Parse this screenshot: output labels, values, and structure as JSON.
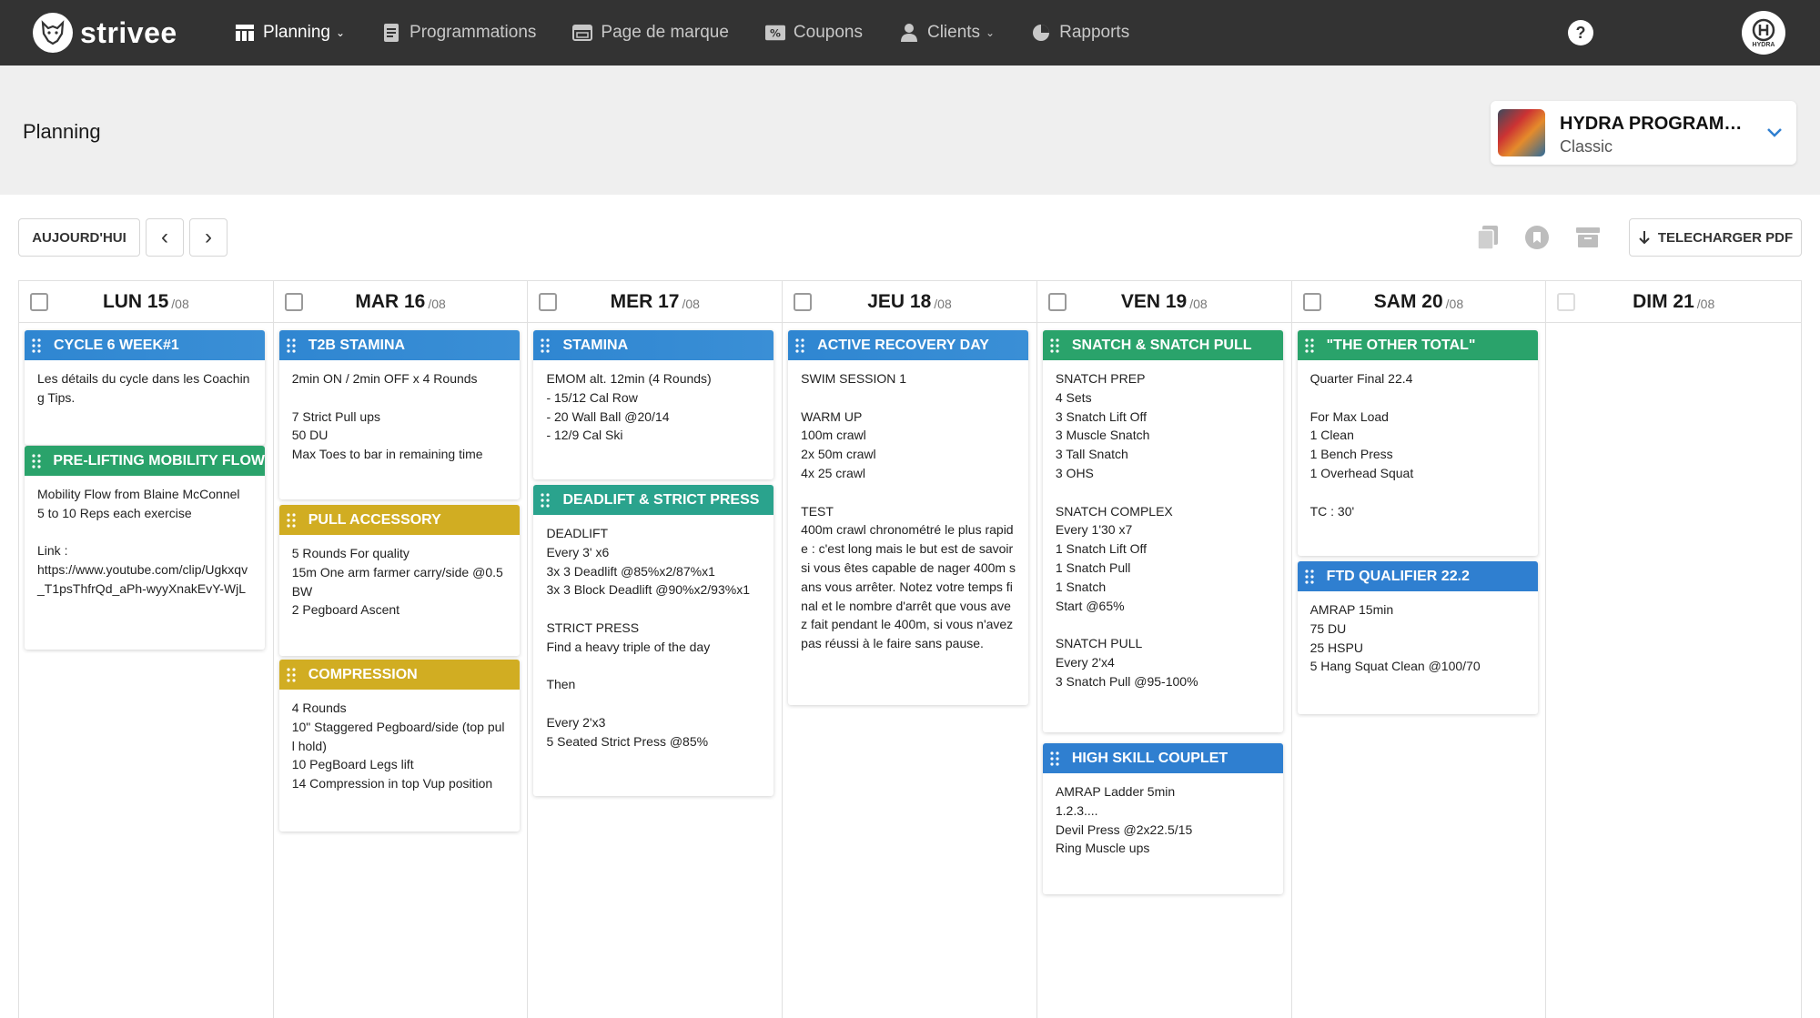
{
  "brand": {
    "name": "strivee"
  },
  "nav": [
    {
      "label": "Planning",
      "icon": "layout-icon",
      "active": true,
      "dropdown": true
    },
    {
      "label": "Programmations",
      "icon": "document-icon",
      "active": false,
      "dropdown": false
    },
    {
      "label": "Page de marque",
      "icon": "browser-window-icon",
      "active": false,
      "dropdown": false
    },
    {
      "label": "Coupons",
      "icon": "percent-tag-icon",
      "active": false,
      "dropdown": false
    },
    {
      "label": "Clients",
      "icon": "user-icon",
      "active": false,
      "dropdown": true
    },
    {
      "label": "Rapports",
      "icon": "pie-chart-icon",
      "active": false,
      "dropdown": false
    }
  ],
  "help": {
    "label": "?"
  },
  "avatar": {
    "label": "HYDRA"
  },
  "header": {
    "title": "Planning",
    "program": {
      "name": "HYDRA PROGRAMMI...",
      "subtitle": "Classic"
    }
  },
  "toolbar": {
    "today": "AUJOURD'HUI",
    "prev": "‹",
    "next": "›",
    "download": "TELECHARGER PDF"
  },
  "days": [
    {
      "label": "LUN 15",
      "suffix": "/08",
      "cards": [
        {
          "title": "CYCLE 6 WEEK#1",
          "color": "blue",
          "body": "Les détails du cycle dans les Coaching Tips."
        },
        {
          "title": "PRE-LIFTING MOBILITY FLOW",
          "color": "green",
          "body": "Mobility Flow from Blaine McConnel\n5 to 10 Reps each exercise\n\nLink :\nhttps://www.youtube.com/clip/Ugkxqv_T1psThfrQd_aPh-wyyXnakEvY-WjL"
        }
      ]
    },
    {
      "label": "MAR 16",
      "suffix": "/08",
      "cards": [
        {
          "title": "T2B STAMINA",
          "color": "blue",
          "body": "2min ON / 2min OFF x 4 Rounds\n\n7 Strict Pull ups\n50 DU\nMax Toes to bar in remaining time"
        },
        {
          "title": "PULL ACCESSORY",
          "color": "gold",
          "body": "5 Rounds For quality\n15m One arm farmer carry/side @0.5 BW\n2 Pegboard Ascent"
        },
        {
          "title": "COMPRESSION",
          "color": "gold",
          "body": "4 Rounds\n10\" Staggered Pegboard/side (top pull hold)\n10 PegBoard Legs lift\n14 Compression in top Vup position"
        }
      ]
    },
    {
      "label": "MER 17",
      "suffix": "/08",
      "cards": [
        {
          "title": "STAMINA",
          "color": "blue",
          "body": "EMOM alt. 12min (4 Rounds)\n- 15/12 Cal Row\n- 20 Wall Ball @20/14\n- 12/9 Cal Ski"
        },
        {
          "title": "DEADLIFT & STRICT PRESS",
          "color": "teal",
          "body": "DEADLIFT\nEvery 3' x6\n3x 3 Deadlift @85%x2/87%x1\n3x 3 Block Deadlift @90%x2/93%x1\n\nSTRICT PRESS\nFind a heavy triple of the day\n\nThen\n\nEvery 2'x3\n5 Seated Strict Press @85%"
        }
      ]
    },
    {
      "label": "JEU 18",
      "suffix": "/08",
      "cards": [
        {
          "title": "ACTIVE RECOVERY DAY",
          "color": "blue",
          "body": "SWIM SESSION 1\n\nWARM UP\n100m crawl\n2x 50m crawl\n4x 25 crawl\n\nTEST\n400m crawl chronométré le plus rapide : c'est long mais le but est de savoir si vous êtes capable de nager 400m sans vous arrêter. Notez votre temps final et le nombre d'arrêt que vous avez fait pendant le 400m, si vous n'avez pas réussi à le faire sans pause."
        }
      ]
    },
    {
      "label": "VEN 19",
      "suffix": "/08",
      "cards": [
        {
          "title": "SNATCH & SNATCH PULL",
          "color": "green",
          "body": "SNATCH PREP\n4 Sets\n3 Snatch Lift Off\n3 Muscle Snatch\n3 Tall Snatch\n3 OHS\n\nSNATCH COMPLEX\nEvery 1'30 x7\n1 Snatch Lift Off\n1 Snatch Pull\n1 Snatch\nStart @65%\n\nSNATCH PULL\nEvery 2'x4\n3 Snatch Pull @95-100%"
        },
        {
          "title": "HIGH SKILL COUPLET",
          "color": "blue2",
          "body": "AMRAP Ladder 5min\n1.2.3....\nDevil Press @2x22.5/15\nRing Muscle ups"
        }
      ]
    },
    {
      "label": "SAM 20",
      "suffix": "/08",
      "cards": [
        {
          "title": "\"THE OTHER TOTAL\"",
          "color": "green",
          "body": "Quarter Final 22.4\n\nFor Max Load\n1 Clean\n1 Bench Press\n1 Overhead Squat\n\nTC : 30'"
        },
        {
          "title": "FTD QUALIFIER 22.2",
          "color": "blue2",
          "body": "AMRAP 15min\n75 DU\n25 HSPU\n5 Hang Squat Clean @100/70"
        }
      ]
    },
    {
      "label": "DIM 21",
      "suffix": "/08",
      "cards": []
    }
  ]
}
